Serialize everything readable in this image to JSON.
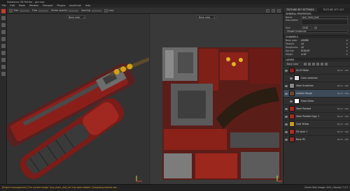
{
  "window": {
    "title": "Substance 3D Painter - gun.spp"
  },
  "menu": [
    "File",
    "Edit",
    "Mode",
    "Window",
    "Viewport",
    "Plugins",
    "JavaScript",
    "Help"
  ],
  "toolbar": {
    "size_label": "Size",
    "flow_label": "Flow",
    "stroke_label": "Stroke opacity",
    "spacing_label": "Spacing",
    "lazy_label": "Lazy"
  },
  "viewport3d": {
    "mode": "Base color"
  },
  "viewport2d": {
    "mode": "Base color"
  },
  "panel": {
    "tabs": [
      "TEXTURE SET SETTINGS",
      "TEXTURE SET LIST"
    ],
    "general": {
      "header": "GENERAL PROPERTIES",
      "name_label": "Name",
      "name_value": "gun_main_mat",
      "desc_label": "Description",
      "size_label": "Size",
      "size_value": "2048",
      "shader_label": "Shader Instances"
    },
    "channels": {
      "header": "CHANNELS",
      "items": [
        {
          "label": "Base color",
          "value": "sRGB8"
        },
        {
          "label": "Metallic",
          "value": "L8"
        },
        {
          "label": "Roughness",
          "value": "L8"
        },
        {
          "label": "Normal",
          "value": "RGB16F"
        },
        {
          "label": "Height",
          "value": "L16F"
        }
      ]
    },
    "layers": {
      "header": "LAYERS",
      "filter": "Base color",
      "items": [
        {
          "name": "Sci-Fi Metal",
          "blend": "Norm",
          "opacity": "100",
          "sub": false,
          "color": "#8a2020"
        },
        {
          "name": "Color selection",
          "blend": "",
          "opacity": "",
          "sub": true,
          "color": "#dddddd"
        },
        {
          "name": "Steel Scratches",
          "blend": "Norm",
          "opacity": "100",
          "sub": false,
          "color": "#888888"
        },
        {
          "name": "Leather Rough",
          "blend": "Norm",
          "opacity": "100",
          "sub": false,
          "color": "#6a4a30"
        },
        {
          "name": "Mask Editor",
          "blend": "",
          "opacity": "",
          "sub": true,
          "color": "#ffffff"
        },
        {
          "name": "Steel Painted",
          "blend": "Norm",
          "opacity": "100",
          "sub": false,
          "color": "#aa2a20"
        },
        {
          "name": "Steel Painted Copy 1",
          "blend": "Norm",
          "opacity": "100",
          "sub": false,
          "color": "#a52a1f"
        },
        {
          "name": "Gold Yellow",
          "blend": "Norm",
          "opacity": "100",
          "sub": false,
          "color": "#c99a20"
        },
        {
          "name": "Fill layer 1",
          "blend": "Norm",
          "opacity": "100",
          "sub": false,
          "color": "#b02c22"
        },
        {
          "name": "Base Fill",
          "blend": "Norm",
          "opacity": "100",
          "sub": false,
          "color": "#9c2a22"
        }
      ]
    }
  },
  "status": {
    "message": "[Project management] The current image \"gun_main_mat_Ao\" has been baked. Computing texture set...",
    "right": "Cache Disk Usage: 43% | Version 7.4.2"
  },
  "colors": {
    "accent": "#c43c2c",
    "panel": "#2f2f2f",
    "paint_red": "#9b2218",
    "gold": "#d4a017"
  }
}
